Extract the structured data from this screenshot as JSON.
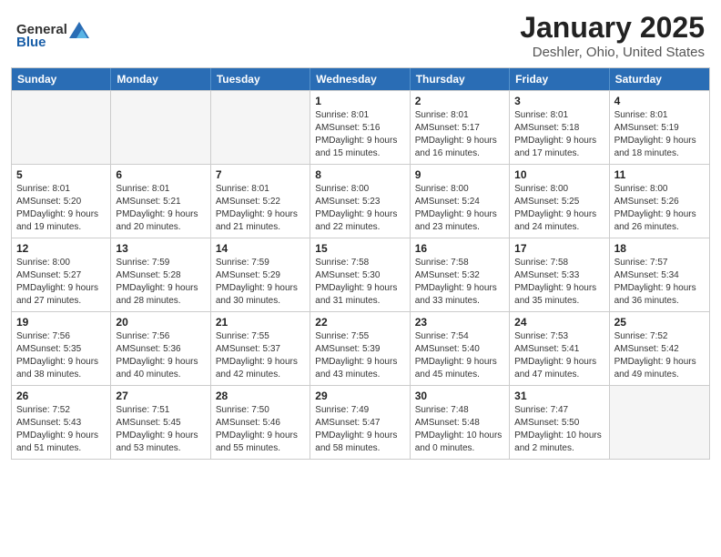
{
  "logo": {
    "general": "General",
    "blue": "Blue"
  },
  "title": "January 2025",
  "subtitle": "Deshler, Ohio, United States",
  "weekdays": [
    "Sunday",
    "Monday",
    "Tuesday",
    "Wednesday",
    "Thursday",
    "Friday",
    "Saturday"
  ],
  "weeks": [
    [
      {
        "day": "",
        "empty": true
      },
      {
        "day": "",
        "empty": true
      },
      {
        "day": "",
        "empty": true
      },
      {
        "day": "1",
        "sunrise": "8:01 AM",
        "sunset": "5:16 PM",
        "daylight": "9 hours and 15 minutes."
      },
      {
        "day": "2",
        "sunrise": "8:01 AM",
        "sunset": "5:17 PM",
        "daylight": "9 hours and 16 minutes."
      },
      {
        "day": "3",
        "sunrise": "8:01 AM",
        "sunset": "5:18 PM",
        "daylight": "9 hours and 17 minutes."
      },
      {
        "day": "4",
        "sunrise": "8:01 AM",
        "sunset": "5:19 PM",
        "daylight": "9 hours and 18 minutes."
      }
    ],
    [
      {
        "day": "5",
        "sunrise": "8:01 AM",
        "sunset": "5:20 PM",
        "daylight": "9 hours and 19 minutes."
      },
      {
        "day": "6",
        "sunrise": "8:01 AM",
        "sunset": "5:21 PM",
        "daylight": "9 hours and 20 minutes."
      },
      {
        "day": "7",
        "sunrise": "8:01 AM",
        "sunset": "5:22 PM",
        "daylight": "9 hours and 21 minutes."
      },
      {
        "day": "8",
        "sunrise": "8:00 AM",
        "sunset": "5:23 PM",
        "daylight": "9 hours and 22 minutes."
      },
      {
        "day": "9",
        "sunrise": "8:00 AM",
        "sunset": "5:24 PM",
        "daylight": "9 hours and 23 minutes."
      },
      {
        "day": "10",
        "sunrise": "8:00 AM",
        "sunset": "5:25 PM",
        "daylight": "9 hours and 24 minutes."
      },
      {
        "day": "11",
        "sunrise": "8:00 AM",
        "sunset": "5:26 PM",
        "daylight": "9 hours and 26 minutes."
      }
    ],
    [
      {
        "day": "12",
        "sunrise": "8:00 AM",
        "sunset": "5:27 PM",
        "daylight": "9 hours and 27 minutes."
      },
      {
        "day": "13",
        "sunrise": "7:59 AM",
        "sunset": "5:28 PM",
        "daylight": "9 hours and 28 minutes."
      },
      {
        "day": "14",
        "sunrise": "7:59 AM",
        "sunset": "5:29 PM",
        "daylight": "9 hours and 30 minutes."
      },
      {
        "day": "15",
        "sunrise": "7:58 AM",
        "sunset": "5:30 PM",
        "daylight": "9 hours and 31 minutes."
      },
      {
        "day": "16",
        "sunrise": "7:58 AM",
        "sunset": "5:32 PM",
        "daylight": "9 hours and 33 minutes."
      },
      {
        "day": "17",
        "sunrise": "7:58 AM",
        "sunset": "5:33 PM",
        "daylight": "9 hours and 35 minutes."
      },
      {
        "day": "18",
        "sunrise": "7:57 AM",
        "sunset": "5:34 PM",
        "daylight": "9 hours and 36 minutes."
      }
    ],
    [
      {
        "day": "19",
        "sunrise": "7:56 AM",
        "sunset": "5:35 PM",
        "daylight": "9 hours and 38 minutes."
      },
      {
        "day": "20",
        "sunrise": "7:56 AM",
        "sunset": "5:36 PM",
        "daylight": "9 hours and 40 minutes."
      },
      {
        "day": "21",
        "sunrise": "7:55 AM",
        "sunset": "5:37 PM",
        "daylight": "9 hours and 42 minutes."
      },
      {
        "day": "22",
        "sunrise": "7:55 AM",
        "sunset": "5:39 PM",
        "daylight": "9 hours and 43 minutes."
      },
      {
        "day": "23",
        "sunrise": "7:54 AM",
        "sunset": "5:40 PM",
        "daylight": "9 hours and 45 minutes."
      },
      {
        "day": "24",
        "sunrise": "7:53 AM",
        "sunset": "5:41 PM",
        "daylight": "9 hours and 47 minutes."
      },
      {
        "day": "25",
        "sunrise": "7:52 AM",
        "sunset": "5:42 PM",
        "daylight": "9 hours and 49 minutes."
      }
    ],
    [
      {
        "day": "26",
        "sunrise": "7:52 AM",
        "sunset": "5:43 PM",
        "daylight": "9 hours and 51 minutes."
      },
      {
        "day": "27",
        "sunrise": "7:51 AM",
        "sunset": "5:45 PM",
        "daylight": "9 hours and 53 minutes."
      },
      {
        "day": "28",
        "sunrise": "7:50 AM",
        "sunset": "5:46 PM",
        "daylight": "9 hours and 55 minutes."
      },
      {
        "day": "29",
        "sunrise": "7:49 AM",
        "sunset": "5:47 PM",
        "daylight": "9 hours and 58 minutes."
      },
      {
        "day": "30",
        "sunrise": "7:48 AM",
        "sunset": "5:48 PM",
        "daylight": "10 hours and 0 minutes."
      },
      {
        "day": "31",
        "sunrise": "7:47 AM",
        "sunset": "5:50 PM",
        "daylight": "10 hours and 2 minutes."
      },
      {
        "day": "",
        "empty": true
      }
    ]
  ]
}
